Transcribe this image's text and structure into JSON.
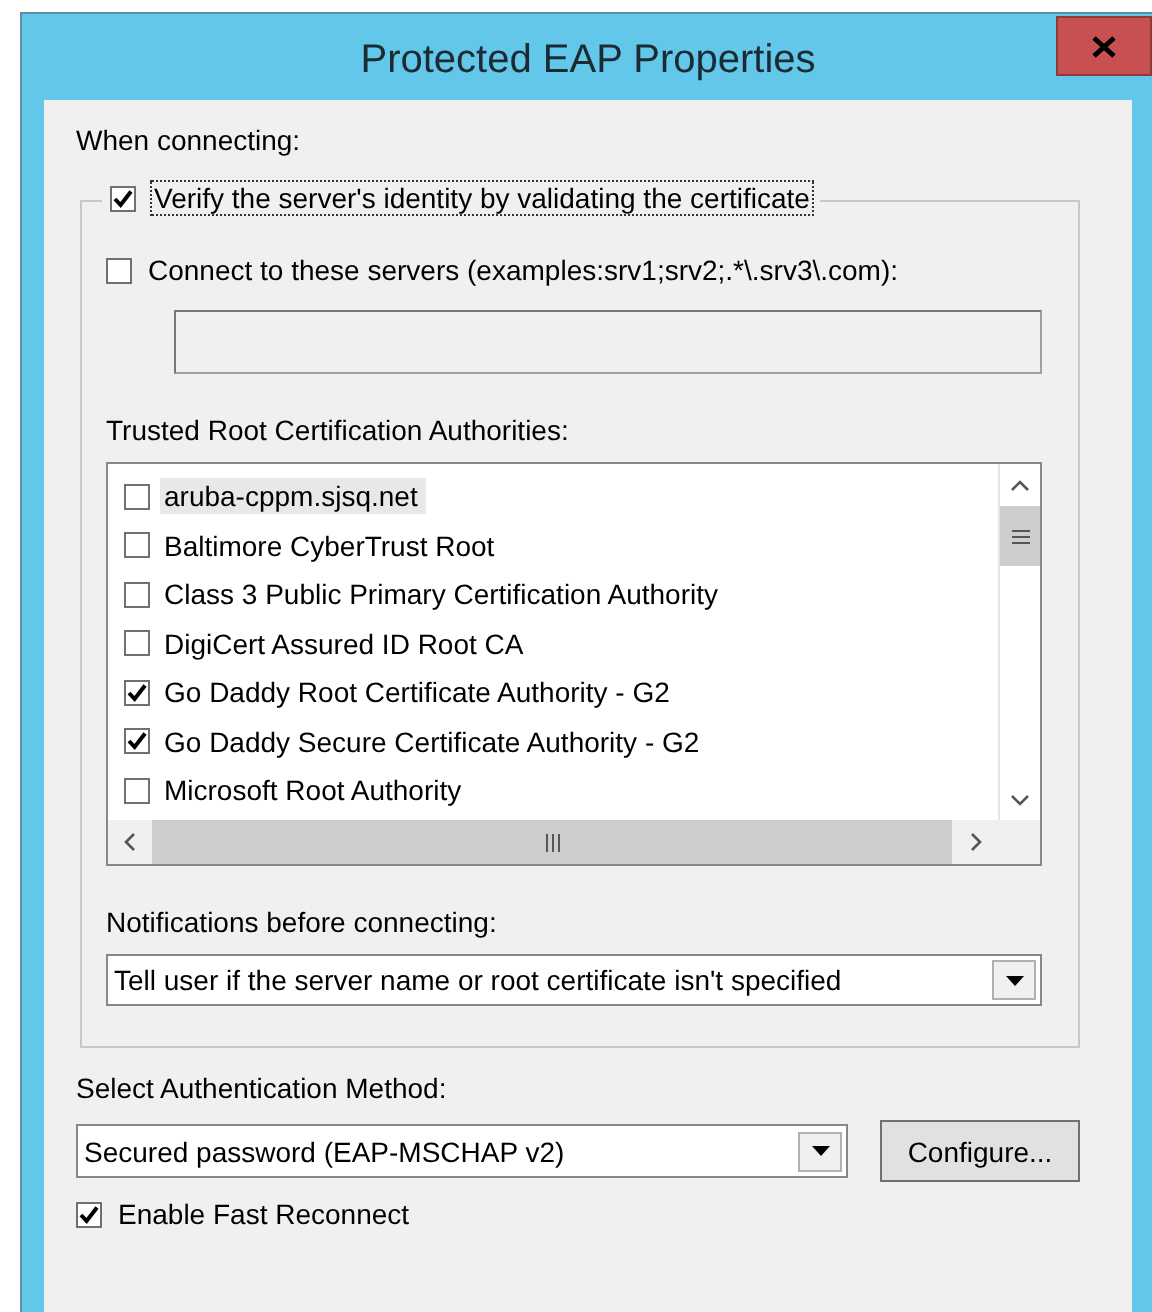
{
  "window": {
    "title": "Protected EAP Properties"
  },
  "when_connecting_label": "When connecting:",
  "verify": {
    "label": "Verify the server's identity by validating the certificate",
    "checked": true
  },
  "connect_servers": {
    "label": "Connect to these servers (examples:srv1;srv2;.*\\.srv3\\.com):",
    "checked": false
  },
  "trusted_root_label": "Trusted Root Certification Authorities:",
  "authorities": [
    {
      "name": "aruba-cppm.sjsq.net",
      "checked": false,
      "selected": true
    },
    {
      "name": "Baltimore CyberTrust Root",
      "checked": false,
      "selected": false
    },
    {
      "name": "Class 3 Public Primary Certification Authority",
      "checked": false,
      "selected": false
    },
    {
      "name": "DigiCert Assured ID Root CA",
      "checked": false,
      "selected": false
    },
    {
      "name": "Go Daddy Root Certificate Authority - G2",
      "checked": true,
      "selected": false
    },
    {
      "name": "Go Daddy Secure Certificate Authority - G2",
      "checked": true,
      "selected": false
    },
    {
      "name": "Microsoft Root Authority",
      "checked": false,
      "selected": false
    }
  ],
  "notifications": {
    "label": "Notifications before connecting:",
    "value": "Tell user if the server name or root certificate isn't specified"
  },
  "auth_method": {
    "label": "Select Authentication Method:",
    "value": "Secured password (EAP-MSCHAP v2)"
  },
  "configure_button": "Configure...",
  "fast_reconnect": {
    "label": "Enable Fast Reconnect",
    "checked": true
  }
}
